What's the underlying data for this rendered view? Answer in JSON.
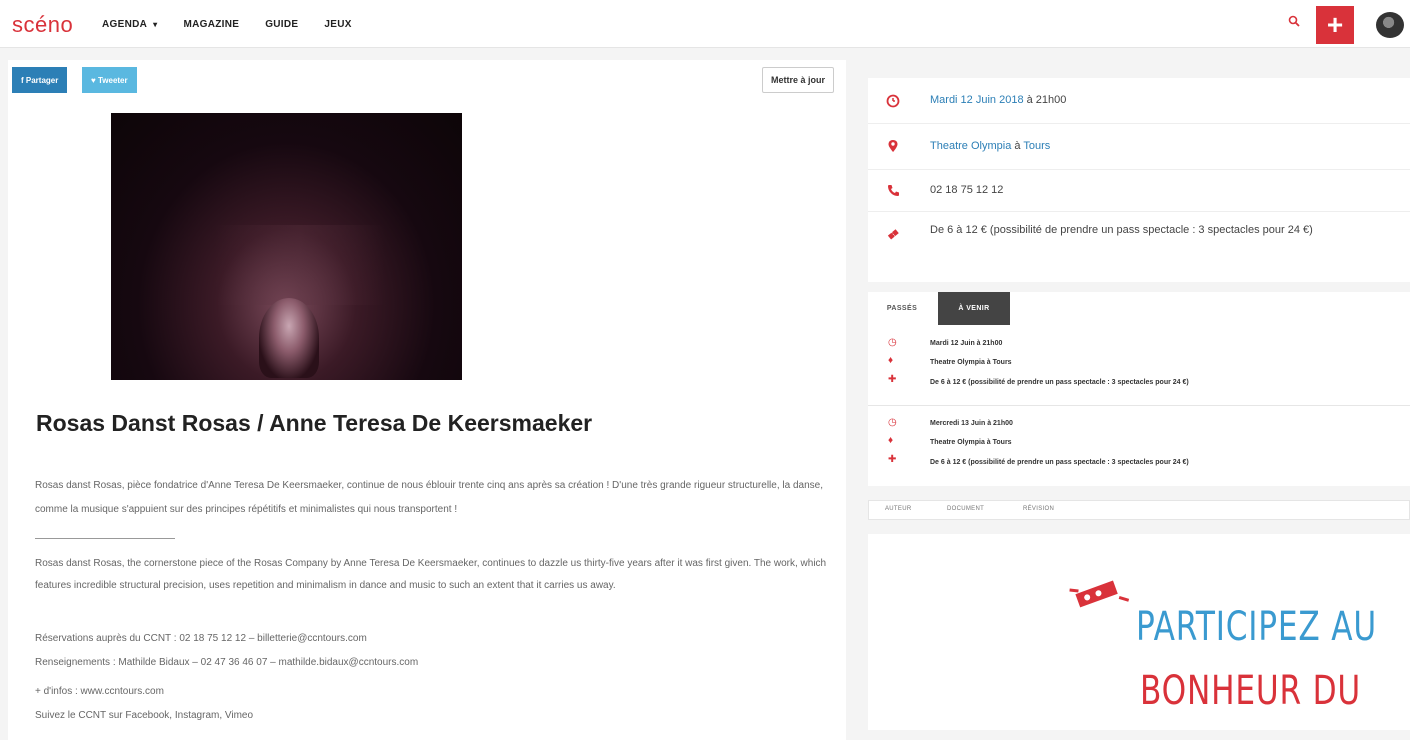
{
  "nav": {
    "logo": "scéno",
    "items": [
      {
        "label": "AGENDA",
        "caret": "▾"
      },
      {
        "label": "MAGAZINE"
      },
      {
        "label": "GUIDE"
      },
      {
        "label": "JEUX"
      }
    ],
    "add_label": "+"
  },
  "share": {
    "facebook": "f Partager",
    "twitter": "♥ Tweeter",
    "update": "Mettre à jour"
  },
  "event": {
    "title": "Rosas Danst Rosas / Anne Teresa De Keersmaeker",
    "desc_fr": "Rosas danst Rosas, pièce fondatrice d'Anne Teresa De Keersmaeker, continue de nous éblouir trente cinq ans après sa création ! D'une très grande rigueur structurelle, la danse, comme la musique s'appuient sur des principes répétitifs et minimalistes qui nous transportent !",
    "desc_en": "Rosas danst Rosas, the cornerstone piece of the Rosas Company by Anne Teresa De Keersmaeker, continues to dazzle us thirty-five years after it was first given. The work, which features incredible structural precision, uses repetition and minimalism in dance and music to such an extent that it carries us away.",
    "reservations": "Réservations auprès du CCNT : 02 18 75 12 12 – billetterie@ccntours.com",
    "renseignements": "Renseignements : Mathilde Bidaux – 02 47 36 46 07 – mathilde.bidaux@ccntours.com",
    "info_link": "+ d'infos : www.ccntours.com",
    "follow": "Suivez le CCNT sur Facebook, Instagram, Vimeo"
  },
  "info": {
    "date": "Mardi 12 Juin 2018",
    "time": "à 21h00",
    "venue": "Theatre Olympia",
    "city_prefix": "à",
    "city": "Tours",
    "phone": "02 18 75 12 12",
    "price": "De 6 à 12 € (possibilité de prendre un pass spectacle : 3 spectacles pour 24 €)"
  },
  "schedule": {
    "tab_past": "PASSÉS",
    "tab_next": "À VENIR",
    "entries": [
      {
        "date": "Mardi 12 Juin à 21h00",
        "venue": "Theatre Olympia à Tours",
        "price": "De 6 à 12 € (possibilité de prendre un pass spectacle : 3 spectacles pour 24 €)"
      },
      {
        "date": "Mercredi 13 Juin à 21h00",
        "venue": "Theatre Olympia à Tours",
        "price": "De 6 à 12 € (possibilité de prendre un pass spectacle : 3 spectacles pour 24 €)"
      }
    ]
  },
  "subtabs": [
    "AUTEUR",
    "DOCUMENT",
    "RÉVISION"
  ],
  "promo": {
    "line1": "PARTICIPEZ AU",
    "line2": "BONHEUR DU"
  },
  "colors": {
    "accent": "#d9323a",
    "link": "#2c7fb6",
    "twitter": "#5ab8e0"
  }
}
